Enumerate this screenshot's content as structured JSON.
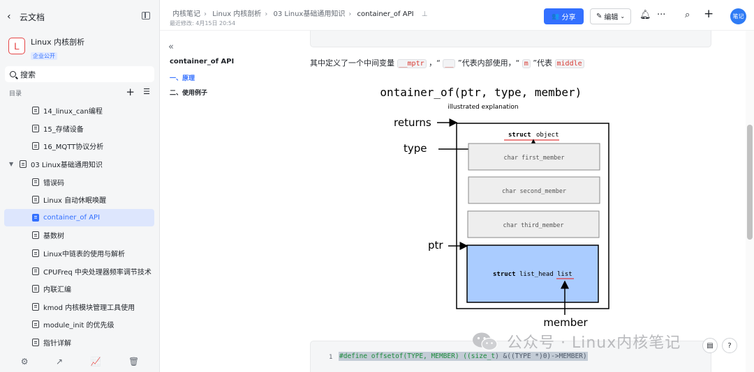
{
  "sidebar": {
    "back_label": "云文档",
    "kb_logo": "L",
    "kb_name": "Linux 内核剖析",
    "kb_badge": "企业公开",
    "search_placeholder": "搜索",
    "toc_label": "目录",
    "items": [
      {
        "label": "14_linux_can编程",
        "indent": 1
      },
      {
        "label": "15_存储设备",
        "indent": 1
      },
      {
        "label": "16_MQTT协议分析",
        "indent": 1
      },
      {
        "label": "03 Linux基础通用知识",
        "indent": 0,
        "expanded": true
      },
      {
        "label": "错误码",
        "indent": 1
      },
      {
        "label": "Linux 自动休眠唤醒",
        "indent": 1
      },
      {
        "label": "container_of API",
        "indent": 1,
        "active": true
      },
      {
        "label": "基数树",
        "indent": 1
      },
      {
        "label": "Linux中链表的使用与解析",
        "indent": 1
      },
      {
        "label": "CPUFreq 中央处理器频率调节技术",
        "indent": 1
      },
      {
        "label": "内联汇编",
        "indent": 1
      },
      {
        "label": "kmod 内核模块管理工具使用",
        "indent": 1
      },
      {
        "label": "module_init 的优先级",
        "indent": 1
      },
      {
        "label": "指针详解",
        "indent": 1
      }
    ]
  },
  "topbar": {
    "breadcrumb": [
      "内核笔记",
      "Linux 内核剖析",
      "03 Linux基础通用知识",
      "container_of API"
    ],
    "last_edited": "最近修改: 4月15日 20:54",
    "share_label": "分享",
    "edit_label": "编辑",
    "avatar_text": "笔记"
  },
  "outline": {
    "title": "container_of API",
    "items": [
      "一、原理",
      "二、使用例子"
    ]
  },
  "content": {
    "para_prefix": "其中定义了一个中间变量",
    "var_mptr": "__mptr",
    "para_mid1": "，“",
    "var_underscore": "__",
    "para_mid2": "”代表内部使用，“",
    "var_m": "m",
    "para_mid3": "”代表",
    "var_middle": "middle",
    "diagram": {
      "title": "container_of(ptr, type, member)",
      "subtitle": "illustrated explanation",
      "returns": "returns",
      "type": "type",
      "ptr": "ptr",
      "member": "member",
      "struct_kw": "struct",
      "struct_name": "object",
      "field1": "char first_member",
      "field2": "char second_member",
      "field3": "char third_member",
      "list_kw": "struct",
      "list_type": "list_head",
      "list_name": "list"
    },
    "code_line_no": "1",
    "code_pre": "#define offsetof(TYPE, MEMBER) ((",
    "code_type": "size_t",
    "code_post": ") &((TYPE *)0)->MEMBER)"
  },
  "watermark": "公众号 · Linux内核笔记",
  "colors": {
    "accent": "#3370ff",
    "list_box": "#aaccff",
    "code_red": "#d83931"
  }
}
